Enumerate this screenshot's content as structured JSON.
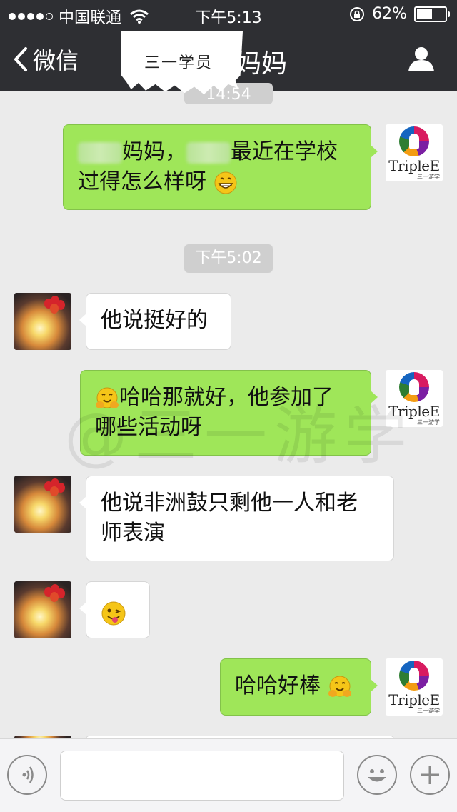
{
  "status_bar": {
    "carrier": "中国联通",
    "time": "下午5:13",
    "battery": "62%",
    "battery_level": 0.62
  },
  "nav": {
    "back_label": "微信",
    "title": "妈妈"
  },
  "sticker": {
    "text": "三一学员"
  },
  "timestamps": {
    "top_partial": "14:54",
    "second": "下午5:02"
  },
  "watermark": "@三一游学",
  "logo": {
    "name": "TripleE",
    "sub": "三一游学"
  },
  "messages": [
    {
      "side": "out",
      "text_a": "妈妈，",
      "text_b": "最近在学校",
      "text_c": "过得怎么样呀"
    },
    {
      "side": "in",
      "text": "他说挺好的"
    },
    {
      "side": "out",
      "text_a": "哈哈那就好，他参加了",
      "text_b": "哪些活动呀"
    },
    {
      "side": "in",
      "text_a": "他说非洲鼓只剩他一人和老",
      "text_b": "师表演"
    },
    {
      "side": "in",
      "emoji": "wink-tongue-emoji"
    },
    {
      "side": "out",
      "text": "哈哈好棒"
    }
  ],
  "input": {
    "placeholder": ""
  },
  "colors": {
    "header": "#2e2f33",
    "outgoing": "#9fe659",
    "incoming": "#ffffff",
    "background": "#ebebeb"
  }
}
